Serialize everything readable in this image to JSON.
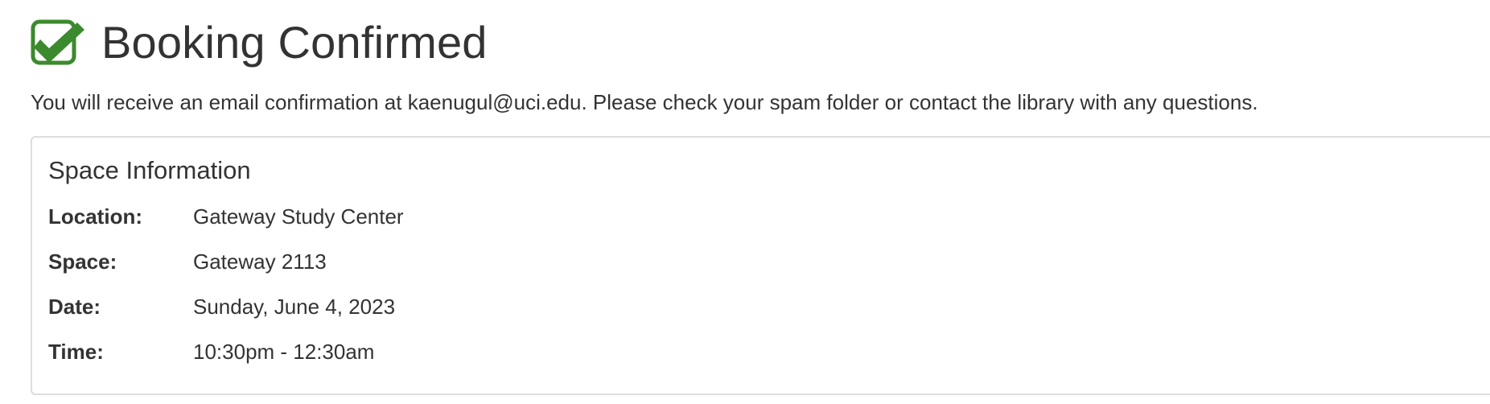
{
  "header": {
    "icon": "check-square-icon",
    "icon_color": "#3c8a2e",
    "title": "Booking Confirmed"
  },
  "notice": {
    "text": "You will receive an email confirmation at kaenugul@uci.edu. Please check your spam folder or contact the library with any questions."
  },
  "space_info": {
    "title": "Space Information",
    "rows": [
      {
        "label": "Location:",
        "value": "Gateway Study Center"
      },
      {
        "label": "Space:",
        "value": "Gateway 2113"
      },
      {
        "label": "Date:",
        "value": "Sunday, June 4, 2023"
      },
      {
        "label": "Time:",
        "value": "10:30pm - 12:30am"
      }
    ]
  }
}
